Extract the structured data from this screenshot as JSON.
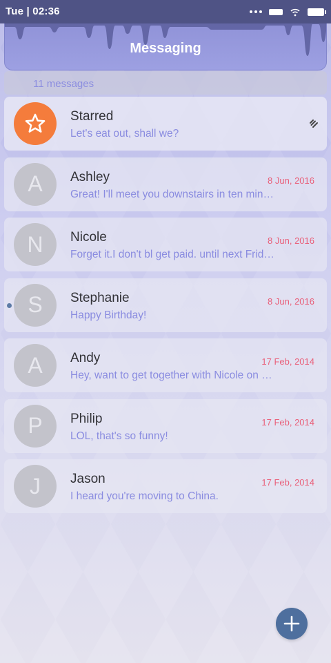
{
  "status_bar": {
    "time": "Tue | 02:36",
    "icons": [
      "signal-dots-icon",
      "battery-small-icon",
      "wifi-icon",
      "battery-icon"
    ]
  },
  "header": {
    "title": "Messaging"
  },
  "summary": {
    "count_text": "11 messages"
  },
  "conversations": [
    {
      "name": "Starred",
      "preview": "Let's eat out, shall we?",
      "date": "",
      "avatar": "star-icon",
      "pinned": true,
      "unread": false
    },
    {
      "name": "Ashley",
      "preview": "Great! I'll meet you downstairs in ten min…",
      "date": "8 Jun, 2016",
      "avatar_letter": "A",
      "unread": false
    },
    {
      "name": "Nicole",
      "preview": "Forget it.I don't bl get paid. until next Frid…",
      "date": "8 Jun, 2016",
      "avatar_letter": "N",
      "unread": false
    },
    {
      "name": "Stephanie",
      "preview": "Happy Birthday!",
      "date": "8 Jun, 2016",
      "avatar_letter": "S",
      "unread": true
    },
    {
      "name": "Andy",
      "preview": "Hey, want to get together with Nicole on …",
      "date": "17 Feb, 2014",
      "avatar_letter": "A",
      "unread": false
    },
    {
      "name": "Philip",
      "preview": "LOL, that's so funny!",
      "date": "17 Feb, 2014",
      "avatar_letter": "P",
      "unread": false
    },
    {
      "name": "Jason",
      "preview": "I heard you're moving to China.",
      "date": "17 Feb, 2014",
      "avatar_letter": "J",
      "unread": false
    }
  ],
  "fab": {
    "icon": "plus-icon"
  },
  "colors": {
    "accent": "#8a8ce0",
    "date": "#e9607a",
    "starred_avatar": "#f47c3c",
    "fab": "#4e6f9e",
    "status_bar": "#4f5385"
  }
}
